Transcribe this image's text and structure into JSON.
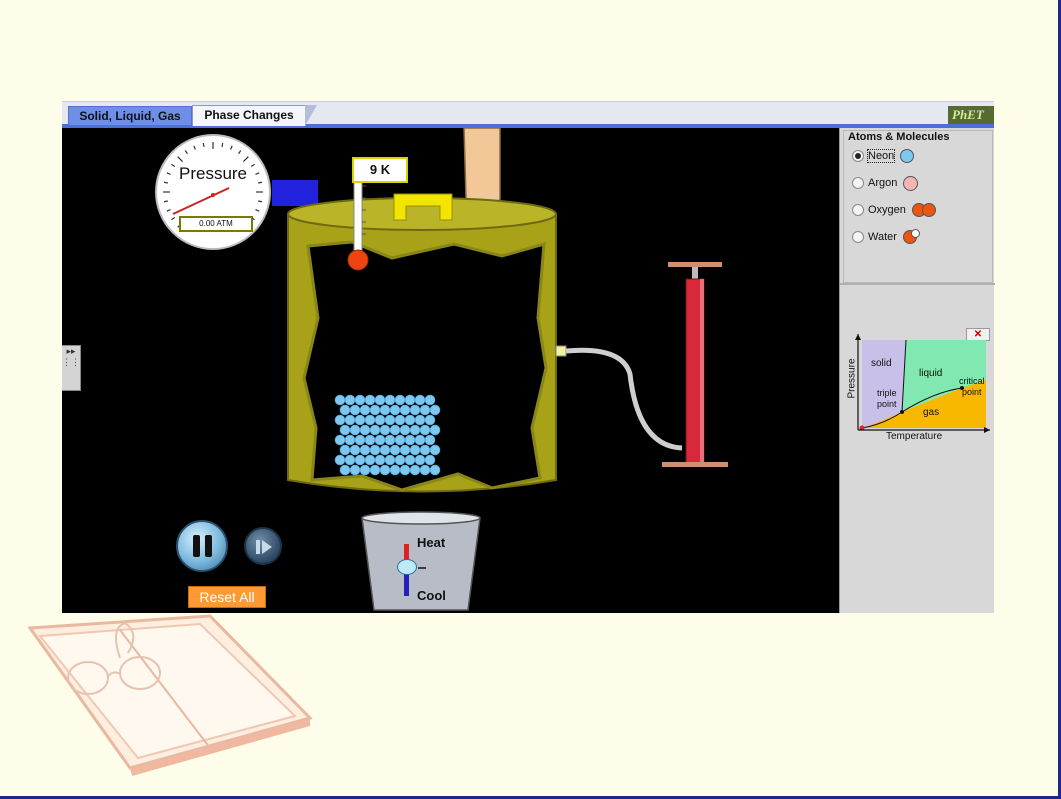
{
  "tabs": [
    {
      "label": "Solid, Liquid, Gas"
    },
    {
      "label": "Phase Changes"
    }
  ],
  "logo": {
    "text": "PhET"
  },
  "gauge": {
    "title": "Pressure",
    "readout": "0.00 ATM"
  },
  "thermometer": {
    "readout": "9 K"
  },
  "heat_control": {
    "heat_label": "Heat",
    "cool_label": "Cool"
  },
  "controls": {
    "reset_label": "Reset All"
  },
  "molecules_panel": {
    "title": "Atoms & Molecules",
    "options": [
      {
        "label": "Neon",
        "selected": true,
        "color": "#7dc8f0"
      },
      {
        "label": "Argon",
        "selected": false,
        "color": "#f6b4b4"
      },
      {
        "label": "Oxygen",
        "selected": false,
        "color": "#ee5511"
      },
      {
        "label": "Water",
        "selected": false,
        "color": "#ee5511"
      }
    ]
  },
  "phase_diagram": {
    "close_label": "✕",
    "y_label": "Pressure",
    "x_label": "Temperature",
    "regions": {
      "solid": "solid",
      "liquid": "liquid",
      "gas": "gas"
    },
    "triple_point": [
      "triple",
      "point"
    ],
    "critical_point": [
      "critical",
      "point"
    ]
  },
  "colors": {
    "container": "#a8a218",
    "container_dark": "#7a7412",
    "particles": "#7dc8f0",
    "background": "#fefde9"
  }
}
